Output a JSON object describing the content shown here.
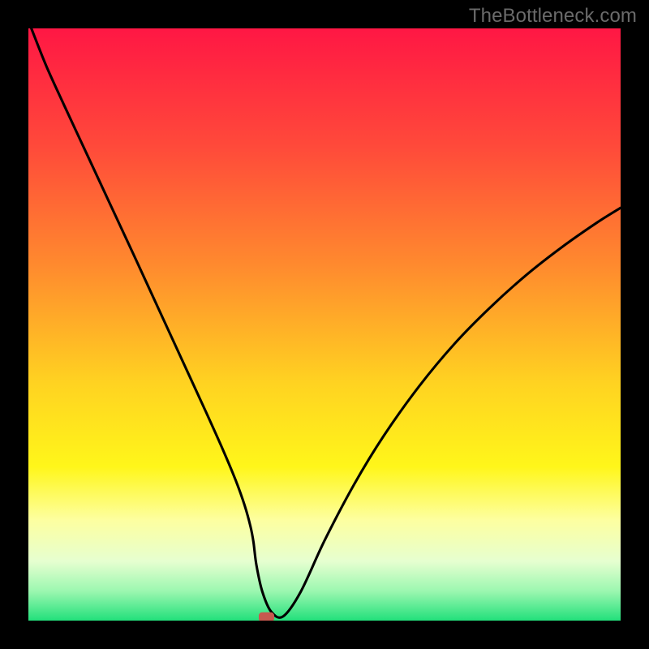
{
  "watermark": "TheBottleneck.com",
  "chart_data": {
    "type": "line",
    "title": "",
    "xlabel": "",
    "ylabel": "",
    "xlim": [
      0,
      100
    ],
    "ylim": [
      0,
      100
    ],
    "background": {
      "type": "vertical_gradient",
      "stops": [
        {
          "offset": 0.0,
          "color": "#ff1744"
        },
        {
          "offset": 0.2,
          "color": "#ff4a3a"
        },
        {
          "offset": 0.4,
          "color": "#ff8a2e"
        },
        {
          "offset": 0.6,
          "color": "#ffd321"
        },
        {
          "offset": 0.74,
          "color": "#fff61a"
        },
        {
          "offset": 0.83,
          "color": "#fdffa0"
        },
        {
          "offset": 0.9,
          "color": "#e6ffd0"
        },
        {
          "offset": 0.95,
          "color": "#9cf7b0"
        },
        {
          "offset": 1.0,
          "color": "#22e07b"
        }
      ]
    },
    "series": [
      {
        "name": "bottleneck-curve",
        "x": [
          0.5,
          3,
          6,
          10,
          14,
          18,
          22,
          26,
          30,
          33,
          35,
          36.5,
          37.5,
          38,
          38.5,
          39.5,
          41,
          43,
          46,
          50,
          55,
          60,
          66,
          72,
          78,
          84,
          90,
          96,
          100
        ],
        "y": [
          100,
          93.7,
          87.1,
          78.5,
          69.9,
          61.3,
          52.6,
          43.9,
          35.2,
          28.5,
          23.7,
          19.5,
          15.9,
          13.3,
          9.4,
          4.9,
          1.5,
          0.7,
          4.9,
          13.5,
          23.0,
          31.2,
          39.6,
          46.8,
          52.9,
          58.3,
          63.0,
          67.2,
          69.7
        ]
      }
    ],
    "marker": {
      "name": "optimal-point",
      "x": 40.2,
      "y": 0.6,
      "color": "#c7594f",
      "shape": "rounded-rect",
      "width": 2.6,
      "height": 1.6
    }
  }
}
